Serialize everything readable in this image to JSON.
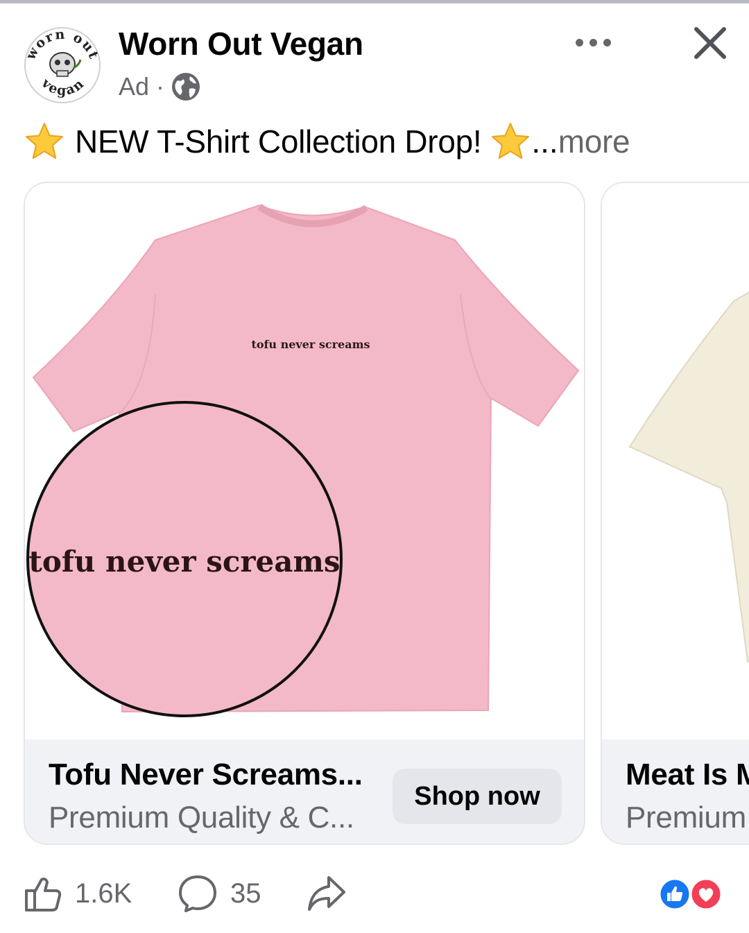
{
  "post": {
    "page_name": "Worn Out Vegan",
    "logo_text_top": "worn out",
    "logo_text_bottom": "vegan",
    "ad_label": "Ad",
    "separator": "·",
    "caption_text": "NEW T-Shirt Collection Drop!",
    "caption_ellipsis": "...",
    "caption_more": "more"
  },
  "carousel": {
    "cards": [
      {
        "shirt_print": "tofu never screams",
        "zoom_text": "tofu never screams",
        "shirt_color": "#f4b9c8",
        "title": "Tofu Never Screams...",
        "subtitle": "Premium Quality & C...",
        "cta": "Shop now"
      },
      {
        "shirt_color": "#f2ecdb",
        "title": "Meat Is M",
        "subtitle": "Premium"
      }
    ]
  },
  "engagement": {
    "likes": "1.6K",
    "comments": "35",
    "reactions": [
      "like-icon",
      "love-icon"
    ],
    "like_color": "#1877f2",
    "love_color": "#f33e58"
  }
}
